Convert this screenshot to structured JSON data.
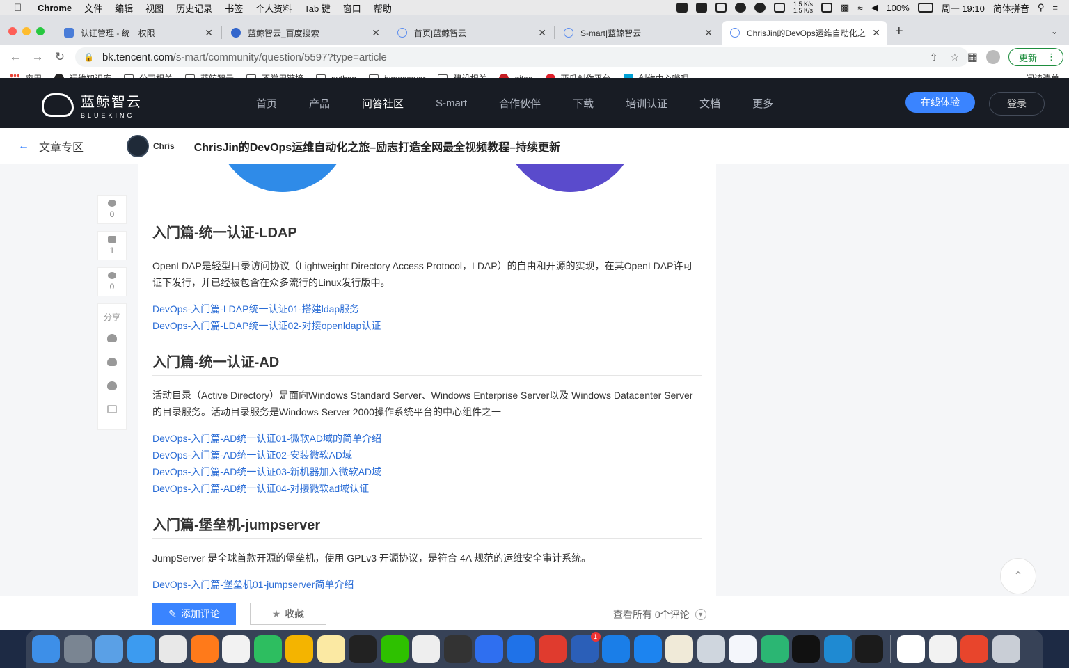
{
  "menubar": {
    "app": "Chrome",
    "items": [
      "文件",
      "编辑",
      "视图",
      "历史记录",
      "书签",
      "个人资料",
      "Tab 键",
      "窗口",
      "帮助"
    ],
    "net_up": "1.5 K/s",
    "net_down": "1.5 K/s",
    "battery": "100%",
    "datetime": "周一 19:10",
    "input_method": "简体拼音"
  },
  "tabs": [
    {
      "title": "认证管理 - 统一权限",
      "favicon_color": "#4a7dd8"
    },
    {
      "title": "蓝鲸智云_百度搜索",
      "favicon_color": "#3366cc"
    },
    {
      "title": "首页|蓝鲸智云",
      "favicon_color": "#5b8def"
    },
    {
      "title": "S-mart|蓝鲸智云",
      "favicon_color": "#5b8def"
    },
    {
      "title": "ChrisJin的DevOps运维自动化之",
      "favicon_color": "#5b8def"
    }
  ],
  "toolbar": {
    "url_host": "bk.tencent.com",
    "url_path": "/s-mart/community/question/5597?type=article",
    "update_label": "更新"
  },
  "bookmarks": [
    {
      "label": "应用",
      "kind": "apps"
    },
    {
      "label": "运维知识库",
      "kind": "dot",
      "color": "#222"
    },
    {
      "label": "公司相关",
      "kind": "folder"
    },
    {
      "label": "蓝鲸智云",
      "kind": "folder"
    },
    {
      "label": "不常用链接",
      "kind": "folder"
    },
    {
      "label": "python",
      "kind": "folder"
    },
    {
      "label": "jumpserver",
      "kind": "folder"
    },
    {
      "label": "建设相关",
      "kind": "folder"
    },
    {
      "label": "gitee",
      "kind": "dot",
      "color": "#c71d23"
    },
    {
      "label": "西瓜创作平台",
      "kind": "dot",
      "color": "#e0202b"
    },
    {
      "label": "创作中心哔哩",
      "kind": "dot",
      "color": "#00a1d6"
    }
  ],
  "reading_list": "阅读清单",
  "site": {
    "logo_cn": "蓝鲸智云",
    "logo_en": "BLUEKING",
    "nav": [
      "首页",
      "产品",
      "问答社区",
      "S-mart",
      "合作伙伴",
      "下载",
      "培训认证",
      "文档",
      "更多"
    ],
    "active_nav": "问答社区",
    "try_label": "在线体验",
    "login_label": "登录"
  },
  "article_bar": {
    "section": "文章专区",
    "author": "Chris",
    "title": "ChrisJin的DevOps运维自动化之旅–励志打造全网最全视频教程–持续更新"
  },
  "side_actions": {
    "comments": "0",
    "likes": "1",
    "stars": "0",
    "share_label": "分享"
  },
  "sections": [
    {
      "heading": "入门篇-统一认证-LDAP",
      "body": "OpenLDAP是轻型目录访问协议（Lightweight Directory Access Protocol，LDAP）的自由和开源的实现，在其OpenLDAP许可证下发行，并已经被包含在众多流行的Linux发行版中。",
      "links": [
        "DevOps-入门篇-LDAP统一认证01-搭建ldap服务",
        "DevOps-入门篇-LDAP统一认证02-对接openldap认证"
      ]
    },
    {
      "heading": "入门篇-统一认证-AD",
      "body": "活动目录（Active Directory）是面向Windows Standard Server、Windows Enterprise Server以及 Windows Datacenter Server的目录服务。活动目录服务是Windows Server 2000操作系统平台的中心组件之一",
      "links": [
        "DevOps-入门篇-AD统一认证01-微软AD域的简单介绍",
        "DevOps-入门篇-AD统一认证02-安装微软AD域",
        "DevOps-入门篇-AD统一认证03-新机器加入微软AD域",
        "DevOps-入门篇-AD统一认证04-对接微软ad域认证"
      ]
    },
    {
      "heading": "入门篇-堡垒机-jumpserver",
      "body": "JumpServer 是全球首款开源的堡垒机，使用 GPLv3 开源协议，是符合 4A 规范的运维安全审计系统。",
      "links": [
        "DevOps-入门篇-堡垒机01-jumpserver简单介绍"
      ]
    }
  ],
  "bottom_bar": {
    "comment_label": "添加评论",
    "fav_label": "收藏",
    "view_all": "查看所有 0个评论"
  },
  "dock": {
    "apps": [
      {
        "name": "finder-icon",
        "color": "#3d8fe8"
      },
      {
        "name": "launchpad-icon",
        "color": "#7a8592"
      },
      {
        "name": "qq-icon",
        "color": "#5aa0e6"
      },
      {
        "name": "safari-icon",
        "color": "#3c9bf0"
      },
      {
        "name": "chrome-icon",
        "color": "#e8e8e8"
      },
      {
        "name": "firefox-icon",
        "color": "#ff7a1a"
      },
      {
        "name": "typora-icon",
        "color": "#f2f2f2"
      },
      {
        "name": "evernote-icon",
        "color": "#2dbe60"
      },
      {
        "name": "photos-icon",
        "color": "#f4b400"
      },
      {
        "name": "notes-icon",
        "color": "#fbe9a3"
      },
      {
        "name": "qq-penguin-icon",
        "color": "#222"
      },
      {
        "name": "wechat-icon",
        "color": "#2ec100"
      },
      {
        "name": "messages-icon",
        "color": "#eee"
      },
      {
        "name": "terminal-zen-icon",
        "color": "#333"
      },
      {
        "name": "feishu-icon",
        "color": "#2f6ff0"
      },
      {
        "name": "sourcetree-icon",
        "color": "#1f72e8"
      },
      {
        "name": "wps-icon",
        "color": "#e03b2e"
      },
      {
        "name": "word-icon",
        "color": "#2b5fb8",
        "badge": "1"
      },
      {
        "name": "k-app-icon",
        "color": "#1a7ee8"
      },
      {
        "name": "testflight-icon",
        "color": "#1c84f0"
      },
      {
        "name": "notebook-icon",
        "color": "#f0ead8"
      },
      {
        "name": "disk-utility-icon",
        "color": "#cfd6de"
      },
      {
        "name": "baidu-netdisk-icon",
        "color": "#f4f6fb"
      },
      {
        "name": "infuse-icon",
        "color": "#2bb673"
      },
      {
        "name": "iterm-icon",
        "color": "#111"
      },
      {
        "name": "vscode-icon",
        "color": "#1f8ad2"
      },
      {
        "name": "pycharm-icon",
        "color": "#1b1b1b"
      },
      {
        "name": "calendar-icon",
        "color": "#fff"
      },
      {
        "name": "textedit-icon",
        "color": "#f2f2f2"
      },
      {
        "name": "preview-icon",
        "color": "#e8452c"
      },
      {
        "name": "trash-icon",
        "color": "#c9ced6"
      }
    ]
  }
}
